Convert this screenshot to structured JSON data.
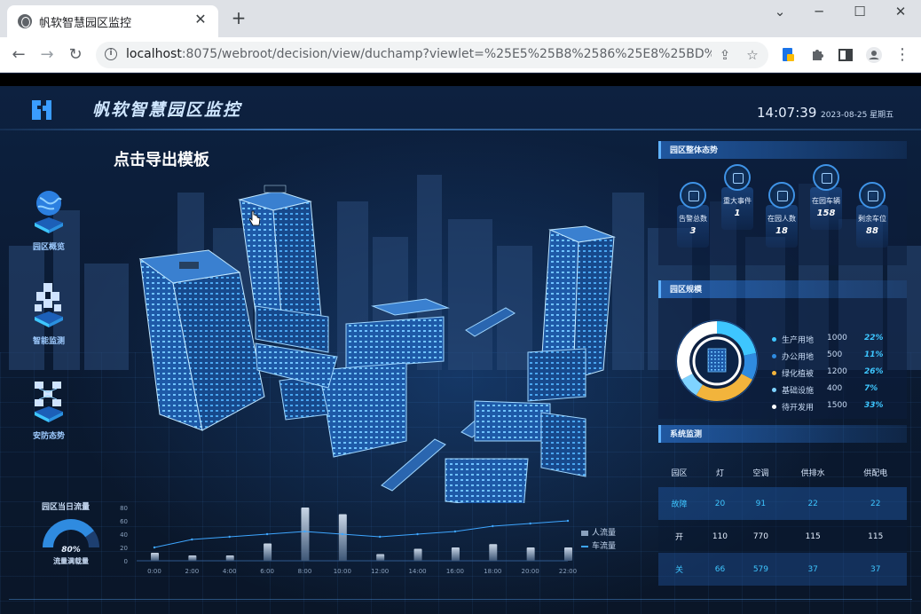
{
  "browser": {
    "tab_title": "帆软智慧园区监控",
    "tab_close": "✕",
    "new_tab": "+",
    "url_host": "localhost",
    "url_rest": ":8075/webroot/decision/view/duchamp?viewlet=%25E5%25B8%2586%25E8%25BD%2...",
    "window": {
      "minimize": "─",
      "maximize": "☐",
      "close": "✕",
      "dropdown": "⌄"
    }
  },
  "header": {
    "title": "帆软智慧园区监控",
    "time": "14:07:39",
    "date": "2023-08-25 星期五"
  },
  "export_title": "点击导出模板",
  "left_nav": [
    {
      "label": "园区概览",
      "icon": "globe-icon"
    },
    {
      "label": "智能监测",
      "icon": "cubes-icon"
    },
    {
      "label": "安防态势",
      "icon": "security-icon"
    }
  ],
  "overview": {
    "title": "园区整体态势",
    "stats": [
      {
        "label": "告警总数",
        "value": "3",
        "icon": "alarm-icon"
      },
      {
        "label": "重大事件",
        "value": "1",
        "icon": "event-icon"
      },
      {
        "label": "在园人数",
        "value": "18",
        "icon": "people-icon"
      },
      {
        "label": "在园车辆",
        "value": "158",
        "icon": "car-icon"
      },
      {
        "label": "剩余车位",
        "value": "88",
        "icon": "parking-icon"
      }
    ]
  },
  "scale": {
    "title": "园区规模",
    "items": [
      {
        "name": "生产用地",
        "value": "1000",
        "pct": "22%",
        "color": "#3ec6ff"
      },
      {
        "name": "办公用地",
        "value": "500",
        "pct": "11%",
        "color": "#2f8be0"
      },
      {
        "name": "绿化植被",
        "value": "1200",
        "pct": "26%",
        "color": "#f2b43c"
      },
      {
        "name": "基础设施",
        "value": "400",
        "pct": "7%",
        "color": "#7fd3ff"
      },
      {
        "name": "待开发用",
        "value": "1500",
        "pct": "33%",
        "color": "#ffffff"
      }
    ]
  },
  "system": {
    "title": "系统监测",
    "columns": [
      "园区",
      "灯",
      "空调",
      "供排水",
      "供配电"
    ],
    "rows": [
      [
        "故障",
        "20",
        "91",
        "22",
        "22"
      ],
      [
        "开",
        "110",
        "770",
        "115",
        "115"
      ],
      [
        "关",
        "66",
        "579",
        "37",
        "37"
      ]
    ]
  },
  "flow": {
    "title": "园区当日流量",
    "gauge_pct": "80%",
    "gauge_label": "流量满载量",
    "legend_people": "人流量",
    "legend_cars": "车流量"
  },
  "chart_data": {
    "type": "bar",
    "categories": [
      "0:00",
      "2:00",
      "4:00",
      "6:00",
      "8:00",
      "10:00",
      "12:00",
      "14:00",
      "16:00",
      "18:00",
      "20:00",
      "22:00"
    ],
    "yticks": [
      "80",
      "60",
      "40",
      "20",
      "0"
    ],
    "ylim": [
      0,
      80
    ],
    "series": [
      {
        "name": "人流量",
        "type": "bar",
        "values": [
          12,
          8,
          8,
          26,
          80,
          70,
          10,
          18,
          20,
          25,
          20,
          20
        ]
      },
      {
        "name": "车流量",
        "type": "line",
        "values": [
          20,
          32,
          36,
          40,
          44,
          40,
          36,
          40,
          44,
          52,
          56,
          60
        ]
      }
    ]
  }
}
